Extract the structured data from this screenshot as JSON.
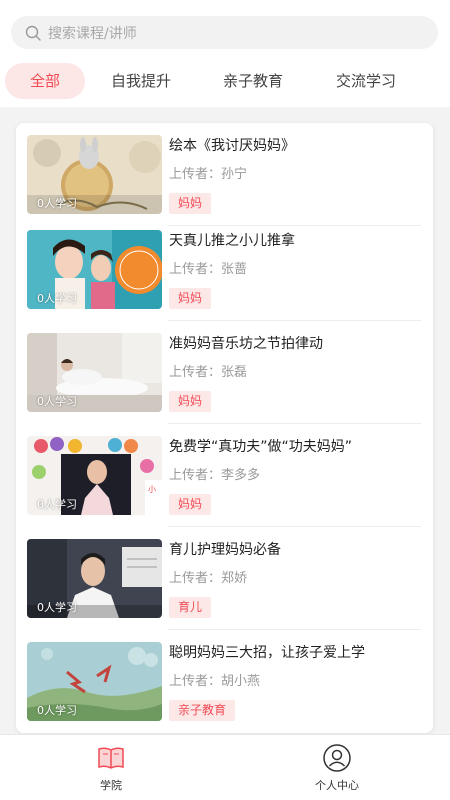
{
  "search": {
    "placeholder": "搜索课程/讲师",
    "icon": "search-icon"
  },
  "tabs": [
    {
      "label": "全部",
      "active": true
    },
    {
      "label": "自我提升",
      "active": false
    },
    {
      "label": "亲子教育",
      "active": false
    },
    {
      "label": "交流学习",
      "active": false
    }
  ],
  "courses": [
    {
      "title": "绘本《我讨厌妈妈》",
      "uploader": "上传者：孙宁",
      "tag": "妈妈",
      "learners": "0人学习"
    },
    {
      "title": "天真儿推之小儿推拿",
      "uploader": "上传者：张蔷",
      "tag": "妈妈",
      "learners": "0人学习"
    },
    {
      "title": "准妈妈音乐坊之节拍律动",
      "uploader": "上传者：张磊",
      "tag": "妈妈",
      "learners": "0人学习"
    },
    {
      "title": "免费学“真功夫”做“功夫妈妈”",
      "uploader": "上传者：李多多",
      "tag": "妈妈",
      "learners": "0人学习"
    },
    {
      "title": "育儿护理妈妈必备",
      "uploader": "上传者：郑娇",
      "tag": "育儿",
      "learners": "0人学习"
    },
    {
      "title": "聪明妈妈三大招，让孩子爱上学",
      "uploader": "上传者：胡小燕",
      "tag": "亲子教育",
      "learners": "0人学习"
    }
  ],
  "nav": [
    {
      "label": "学院",
      "icon": "book-icon",
      "active": true
    },
    {
      "label": "个人中心",
      "icon": "user-icon",
      "active": false
    }
  ],
  "colors": {
    "accent": "#f04b55",
    "tag_bg": "#fde8e8"
  }
}
